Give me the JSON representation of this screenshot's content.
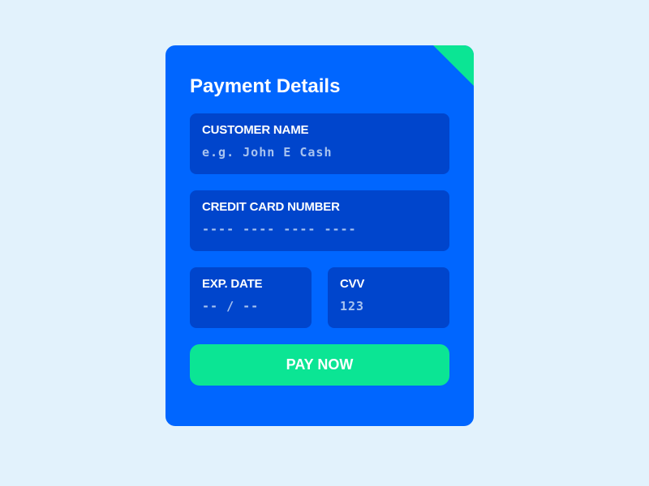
{
  "form": {
    "title": "Payment Details",
    "fields": {
      "customer_name": {
        "label": "CUSTOMER NAME",
        "value": "",
        "placeholder": "e.g. John E Cash"
      },
      "card_number": {
        "label": "CREDIT CARD NUMBER",
        "value": "",
        "placeholder": "---- ---- ---- ----"
      },
      "exp_date": {
        "label": "EXP. DATE",
        "value": "",
        "placeholder": "-- / --"
      },
      "cvv": {
        "label": "CVV",
        "value": "",
        "placeholder": "123"
      }
    },
    "submit_label": "PAY NOW"
  },
  "colors": {
    "page_background": "#e2f2fc",
    "card_background": "#0066ff",
    "field_background": "#0045cc",
    "accent": "#0be594",
    "text": "#ffffff",
    "placeholder": "#a8c3ef"
  }
}
